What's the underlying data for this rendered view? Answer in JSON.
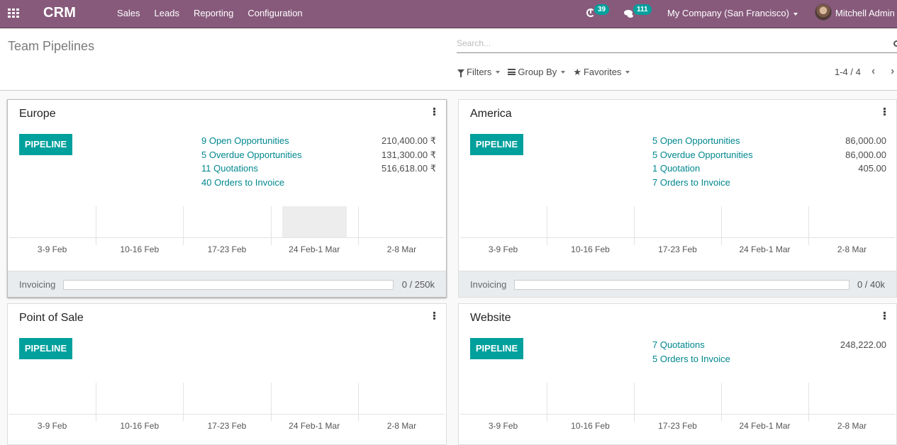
{
  "navbar": {
    "app_name": "CRM",
    "menu": [
      "Sales",
      "Leads",
      "Reporting",
      "Configuration"
    ],
    "activity_count": "39",
    "message_count": "111",
    "company": "My Company (San Francisco)",
    "user": "Mitchell Admin",
    "color": "#875a7b"
  },
  "control_panel": {
    "title": "Team Pipelines",
    "search_placeholder": "Search...",
    "filters_label": "Filters",
    "groupby_label": "Group By",
    "favorites_label": "Favorites",
    "pager": "1-4 / 4"
  },
  "accent_color": "#00a09d",
  "link_color": "#00878e",
  "teams": [
    {
      "name": "Europe",
      "pipeline_label": "PIPELINE",
      "stats": [
        {
          "label": "9 Open Opportunities",
          "value": "210,400.00 ₹"
        },
        {
          "label": "5 Overdue Opportunities",
          "value": "131,300.00 ₹"
        },
        {
          "label": "11 Quotations",
          "value": "516,618.00 ₹"
        },
        {
          "label": "40 Orders to Invoice",
          "value": ""
        }
      ],
      "graph": {
        "weeks": [
          "3-9 Feb",
          "10-16 Feb",
          "17-23 Feb",
          "24 Feb-1 Mar",
          "2-8 Mar"
        ],
        "placeholder_bar_week": 3
      },
      "invoicing": {
        "label": "Invoicing",
        "text": "0 / 250k",
        "current": 0,
        "target": 250000
      }
    },
    {
      "name": "America",
      "pipeline_label": "PIPELINE",
      "stats": [
        {
          "label": "5 Open Opportunities",
          "value": "86,000.00"
        },
        {
          "label": "5 Overdue Opportunities",
          "value": "86,000.00"
        },
        {
          "label": "1 Quotation",
          "value": "405.00"
        },
        {
          "label": "7 Orders to Invoice",
          "value": ""
        }
      ],
      "graph": {
        "weeks": [
          "3-9 Feb",
          "10-16 Feb",
          "17-23 Feb",
          "24 Feb-1 Mar",
          "2-8 Mar"
        ],
        "placeholder_bar_week": -1
      },
      "invoicing": {
        "label": "Invoicing",
        "text": "0 / 40k",
        "current": 0,
        "target": 40000
      }
    },
    {
      "name": "Point of Sale",
      "pipeline_label": "PIPELINE",
      "stats": [],
      "graph": {
        "weeks": [
          "3-9 Feb",
          "10-16 Feb",
          "17-23 Feb",
          "24 Feb-1 Mar",
          "2-8 Mar"
        ],
        "placeholder_bar_week": -1
      }
    },
    {
      "name": "Website",
      "pipeline_label": "PIPELINE",
      "stats": [
        {
          "label": "7 Quotations",
          "value": "248,222.00"
        },
        {
          "label": "5 Orders to Invoice",
          "value": ""
        }
      ],
      "graph": {
        "weeks": [
          "3-9 Feb",
          "10-16 Feb",
          "17-23 Feb",
          "24 Feb-1 Mar",
          "2-8 Mar"
        ],
        "placeholder_bar_week": -1
      }
    }
  ]
}
